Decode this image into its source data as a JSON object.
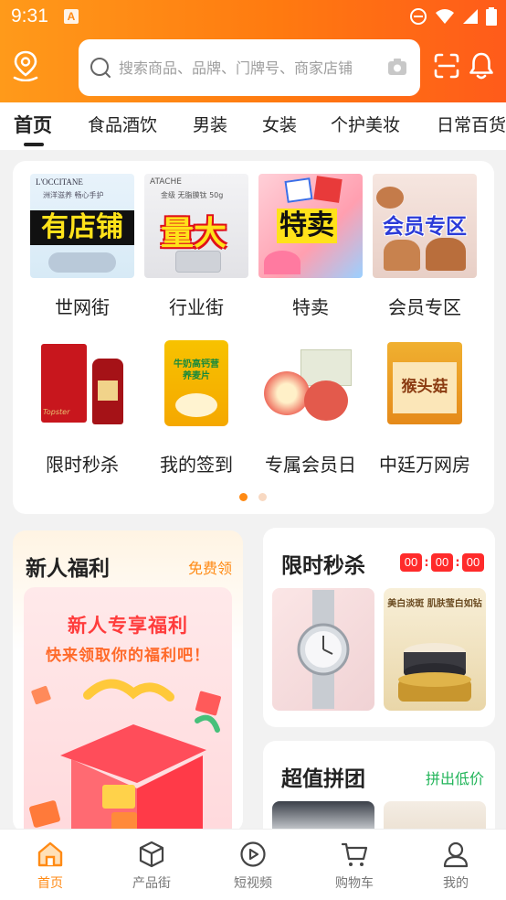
{
  "status_bar": {
    "time": "9:31",
    "notif_letter": "A"
  },
  "search": {
    "placeholder": "搜索商品、品牌、门牌号、商家店铺"
  },
  "tabs": [
    "首页",
    "食品酒饮",
    "男装",
    "女装",
    "个护美妆",
    "日常百货"
  ],
  "categories": [
    {
      "label": "世网街",
      "banner": "有店铺",
      "brand": "L'OCCITANE",
      "sub": "洲洋滋养 畅心手护"
    },
    {
      "label": "行业街",
      "banner": "量大",
      "brand": "ATACHE",
      "sub": "金级 无脂膜钛 50g"
    },
    {
      "label": "特卖",
      "banner": "特卖"
    },
    {
      "label": "会员专区",
      "banner": "会员专区"
    },
    {
      "label": "限时秒杀",
      "pack_text": "Topster"
    },
    {
      "label": "我的签到",
      "pack_text": "牛奶高钙营养麦片"
    },
    {
      "label": "专属会员日"
    },
    {
      "label": "中廷万网房",
      "pack_text": "猴头菇"
    }
  ],
  "newbie": {
    "title": "新人福利",
    "link": "免费领",
    "banner_line1": "新人专享福利",
    "banner_line2": "快来领取你的福利吧！"
  },
  "flash_sale": {
    "title": "限时秒杀",
    "countdown": [
      "00",
      "00",
      "00"
    ],
    "separator": ":",
    "product2_text": "美白淡斑 肌肤莹白如钻"
  },
  "group_buy": {
    "title": "超值拼团",
    "link": "拼出低价"
  },
  "bottom_nav": [
    {
      "label": "首页",
      "icon": "home-icon",
      "active": true
    },
    {
      "label": "产品街",
      "icon": "cube-icon",
      "active": false
    },
    {
      "label": "短视频",
      "icon": "play-icon",
      "active": false
    },
    {
      "label": "购物车",
      "icon": "cart-icon",
      "active": false
    },
    {
      "label": "我的",
      "icon": "user-icon",
      "active": false
    }
  ],
  "colors": {
    "accent": "#ff8a14",
    "header_start": "#ff9a1a",
    "header_end": "#ff5b1a",
    "green": "#22b55a",
    "red": "#ff2b2b"
  }
}
